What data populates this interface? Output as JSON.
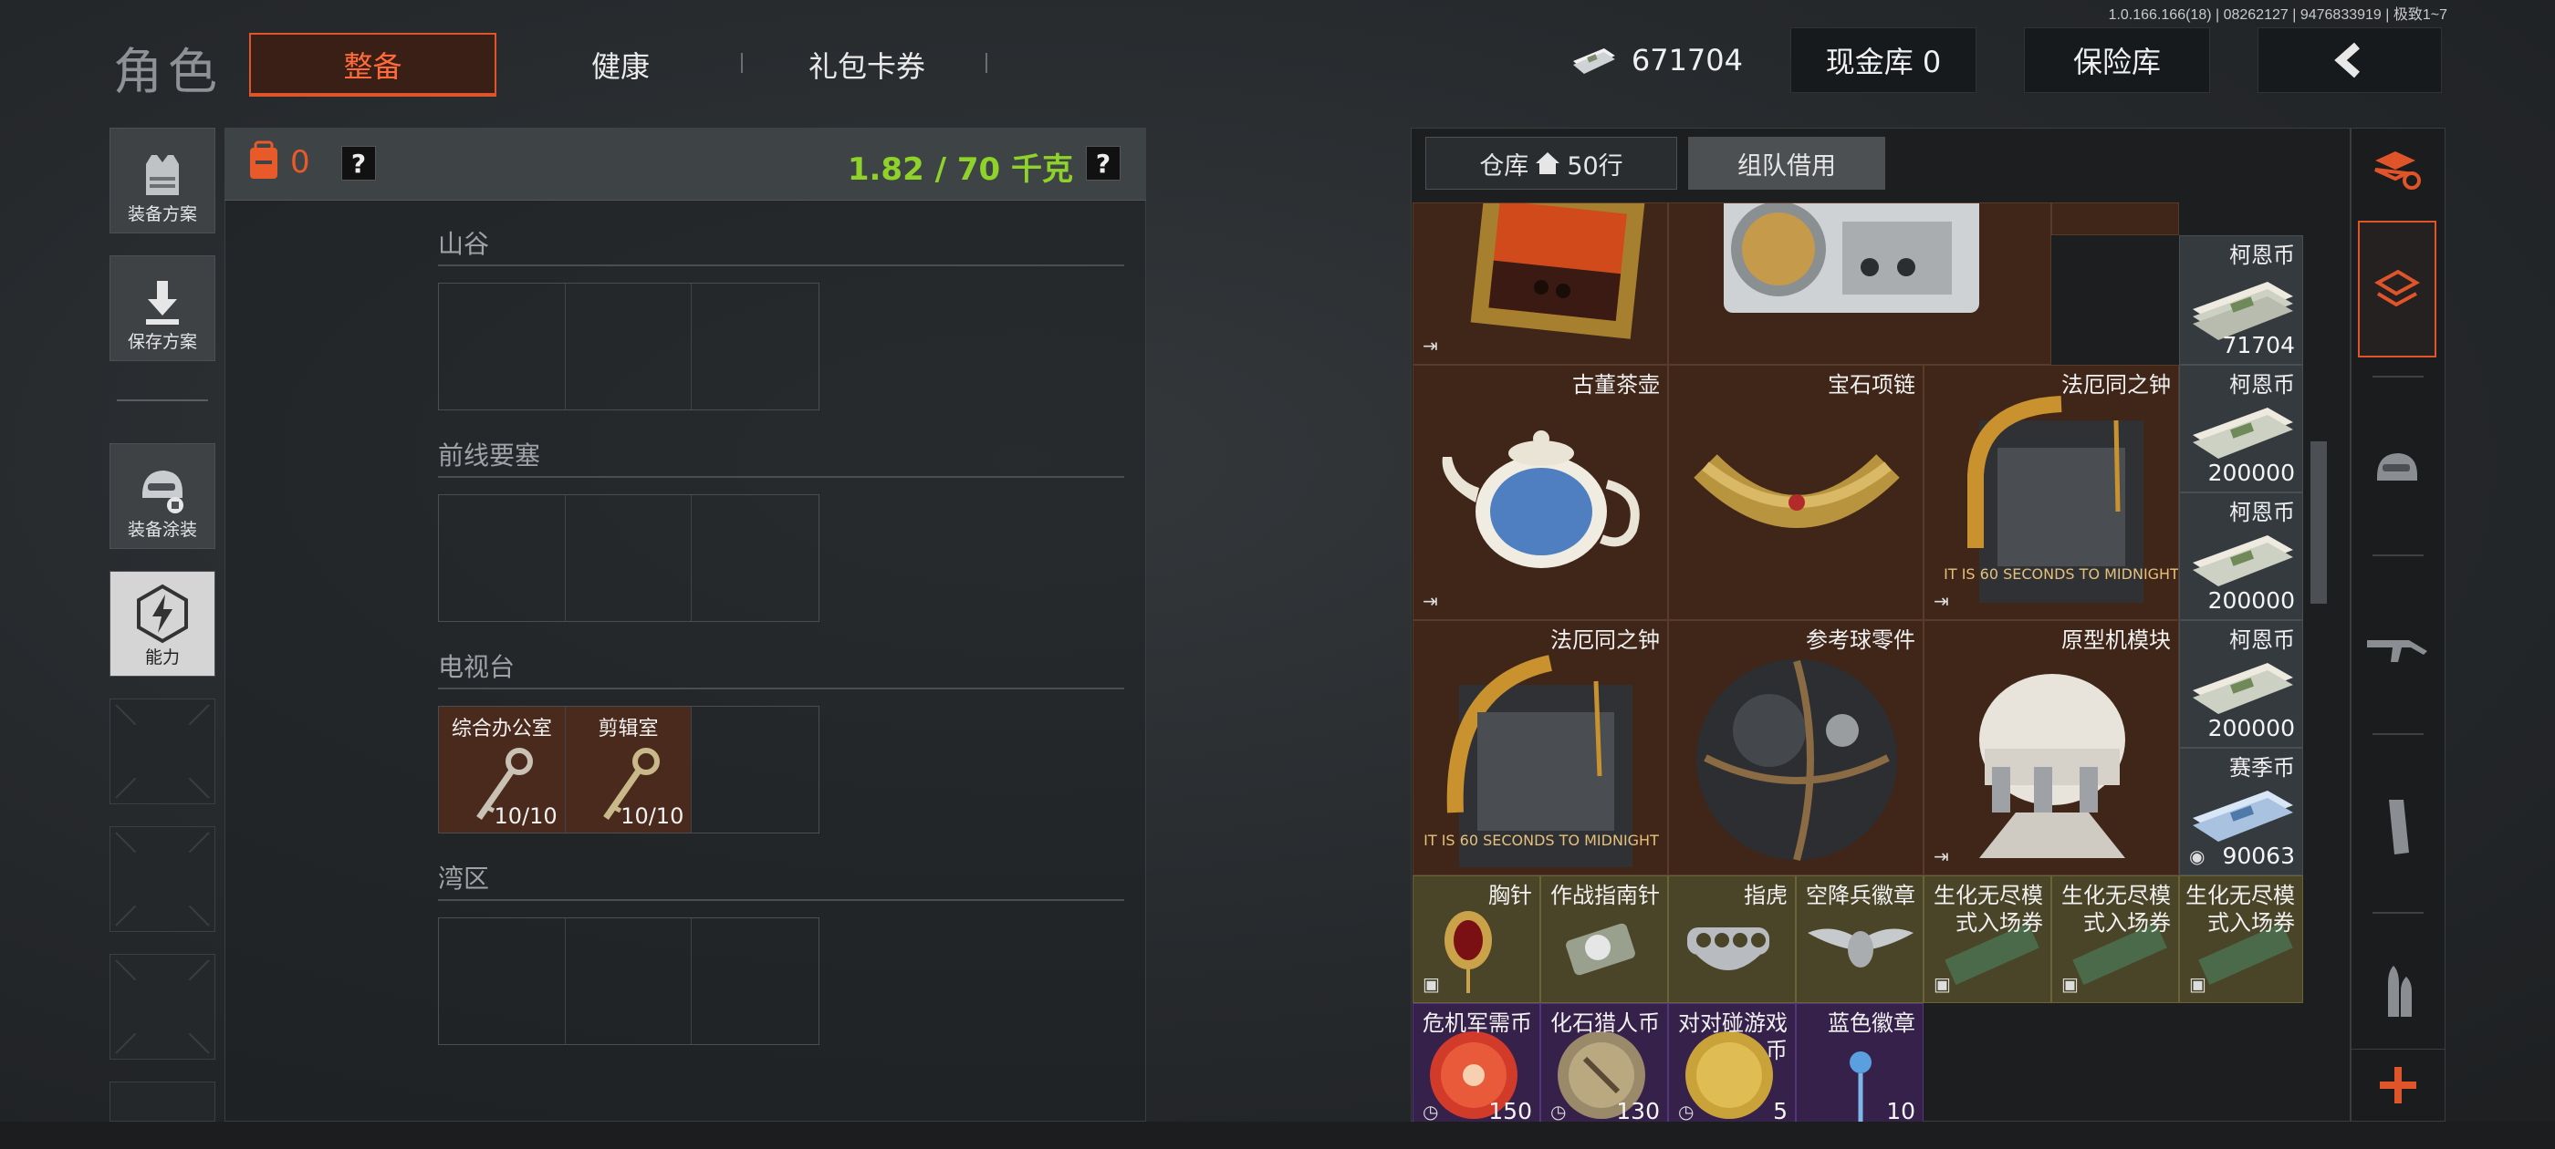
{
  "build_info": "1.0.166.166(18) | 08262127 | 9476833919 | 极致1~7",
  "header": {
    "title": "角色",
    "tabs": [
      {
        "label": "整备",
        "active": true
      },
      {
        "label": "健康"
      },
      {
        "label": "礼包卡券"
      }
    ],
    "money": "671704",
    "cash_vault": "现金库 0",
    "insurance": "保险库"
  },
  "left_rail": [
    {
      "label": "装备方案",
      "icon": "vest-icon"
    },
    {
      "label": "保存方案",
      "icon": "download-icon"
    },
    {
      "label": "装备涂装",
      "icon": "helmet-paint-icon"
    },
    {
      "label": "能力",
      "icon": "ability-icon",
      "active": true
    }
  ],
  "loadout": {
    "backpack_count": "0",
    "help": "?",
    "weight": "1.82 / 70 千克",
    "sections": [
      {
        "title": "山谷",
        "slots": [
          null,
          null,
          null
        ]
      },
      {
        "title": "前线要塞",
        "slots": [
          null,
          null,
          null
        ]
      },
      {
        "title": "电视台",
        "slots": [
          {
            "label": "综合办公室",
            "count": "10/10"
          },
          {
            "label": "剪辑室",
            "count": "10/10"
          },
          null
        ]
      },
      {
        "title": "湾区",
        "slots": [
          null,
          null,
          null
        ]
      }
    ]
  },
  "stash": {
    "tab_warehouse": "仓库",
    "tab_rows": "50行",
    "tab_team": "组队借用",
    "items": {
      "painting": {
        "name": ""
      },
      "radio": {
        "name": ""
      },
      "coin1": {
        "name": "柯恩币",
        "value": "71704"
      },
      "teapot": {
        "name": "古董茶壶"
      },
      "necklace": {
        "name": "宝石项链"
      },
      "clock1": {
        "name": "法厄同之钟",
        "caption": "IT IS 60 SECONDS TO MIDNIGHT"
      },
      "coin2": {
        "name": "柯恩币",
        "value": "200000"
      },
      "coin3": {
        "name": "柯恩币",
        "value": "200000"
      },
      "clock2": {
        "name": "法厄同之钟",
        "caption": "IT IS 60 SECONDS TO MIDNIGHT"
      },
      "sphere": {
        "name": "参考球零件"
      },
      "prototype": {
        "name": "原型机模块"
      },
      "coin4": {
        "name": "柯恩币",
        "value": "200000"
      },
      "season": {
        "name": "赛季币",
        "value": "90063"
      },
      "brooch": {
        "name": "胸针"
      },
      "compass": {
        "name": "作战指南针"
      },
      "knuckles": {
        "name": "指虎"
      },
      "badge": {
        "name": "空降兵徽章"
      },
      "ticket1": {
        "name": "生化无尽模式入场券"
      },
      "ticket2": {
        "name": "生化无尽模式入场券"
      },
      "ticket3": {
        "name": "生化无尽模式入场券"
      },
      "crisis": {
        "name": "危机军需币",
        "value": "150"
      },
      "fossil": {
        "name": "化石猎人币",
        "value": "130"
      },
      "versus": {
        "name": "对对碰游戏币",
        "value": "5"
      },
      "blue": {
        "name": "蓝色徽章",
        "value": "10"
      }
    }
  },
  "colors": {
    "accent": "#e0542a",
    "weight": "#8fd22a",
    "item_bg": "#3f2619"
  }
}
